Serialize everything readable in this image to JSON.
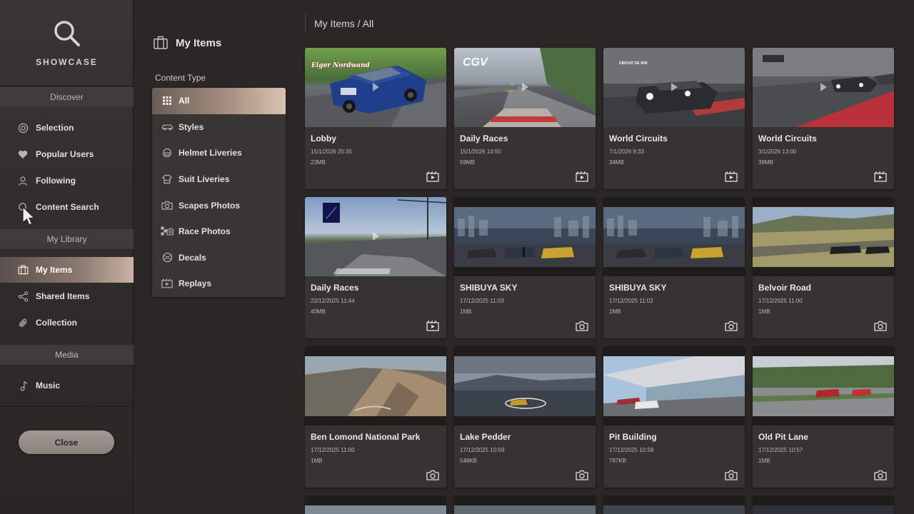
{
  "app": {
    "title": "SHOWCASE"
  },
  "sidebar": {
    "sections": {
      "discover": "Discover",
      "library": "My Library",
      "media": "Media"
    },
    "discover_items": [
      {
        "label": "Selection",
        "icon": "selection-icon"
      },
      {
        "label": "Popular Users",
        "icon": "heart-icon"
      },
      {
        "label": "Following",
        "icon": "user-icon"
      },
      {
        "label": "Content Search",
        "icon": "search-icon"
      }
    ],
    "library_items": [
      {
        "label": "My Items",
        "icon": "briefcase-icon",
        "active": true
      },
      {
        "label": "Shared Items",
        "icon": "share-icon"
      },
      {
        "label": "Collection",
        "icon": "clip-icon"
      }
    ],
    "media_items": [
      {
        "label": "Music",
        "icon": "music-note-icon"
      }
    ],
    "close_label": "Close"
  },
  "panel": {
    "title": "My Items",
    "content_type_label": "Content Type",
    "content_types": [
      {
        "label": "All",
        "icon": "grid-icon",
        "active": true
      },
      {
        "label": "Styles",
        "icon": "car-icon"
      },
      {
        "label": "Helmet Liveries",
        "icon": "helmet-icon"
      },
      {
        "label": "Suit Liveries",
        "icon": "suit-icon"
      },
      {
        "label": "Scapes Photos",
        "icon": "camera-icon"
      },
      {
        "label": "Race Photos",
        "icon": "race-photo-icon"
      },
      {
        "label": "Decals",
        "icon": "decal-icon"
      },
      {
        "label": "Replays",
        "icon": "replay-icon"
      }
    ]
  },
  "breadcrumb": "My Items / All",
  "items": [
    {
      "name": "Lobby",
      "date": "15/1/2026 20:35",
      "size": "23MB",
      "type": "replay",
      "thumb_overlay": "Eiger Nordwand"
    },
    {
      "name": "Daily Races",
      "date": "15/1/2026 14:50",
      "size": "59MB",
      "type": "replay",
      "thumb_overlay": "CGV"
    },
    {
      "name": "World Circuits",
      "date": "7/1/2026 9:33",
      "size": "34MB",
      "type": "replay",
      "thumb_overlay": "CIRCUIT DE SPA"
    },
    {
      "name": "World Circuits",
      "date": "3/1/2026 13:00",
      "size": "38MB",
      "type": "replay",
      "thumb_overlay": ""
    },
    {
      "name": "Daily Races",
      "date": "22/12/2025 11:44",
      "size": "40MB",
      "type": "replay",
      "thumb_overlay": ""
    },
    {
      "name": "SHIBUYA SKY",
      "date": "17/12/2025 11:03",
      "size": "1MB",
      "type": "photo",
      "thumb_overlay": ""
    },
    {
      "name": "SHIBUYA SKY",
      "date": "17/12/2025 11:02",
      "size": "1MB",
      "type": "photo",
      "thumb_overlay": ""
    },
    {
      "name": "Belvoir Road",
      "date": "17/12/2025 11:00",
      "size": "1MB",
      "type": "photo",
      "thumb_overlay": ""
    },
    {
      "name": "Ben Lomond National Park",
      "date": "17/12/2025 11:00",
      "size": "1MB",
      "type": "photo",
      "thumb_overlay": ""
    },
    {
      "name": "Lake Pedder",
      "date": "17/12/2025 10:59",
      "size": "548KB",
      "type": "photo",
      "thumb_overlay": ""
    },
    {
      "name": "Pit Building",
      "date": "17/12/2025 10:58",
      "size": "787KB",
      "type": "photo",
      "thumb_overlay": ""
    },
    {
      "name": "Old Pit Lane",
      "date": "17/12/2025 10:57",
      "size": "1MB",
      "type": "photo",
      "thumb_overlay": ""
    }
  ],
  "colors": {
    "accent_gradient_start": "#5a4f4a",
    "accent_gradient_end": "#c8b3a4",
    "background": "#2b2727",
    "card": "#383333"
  }
}
